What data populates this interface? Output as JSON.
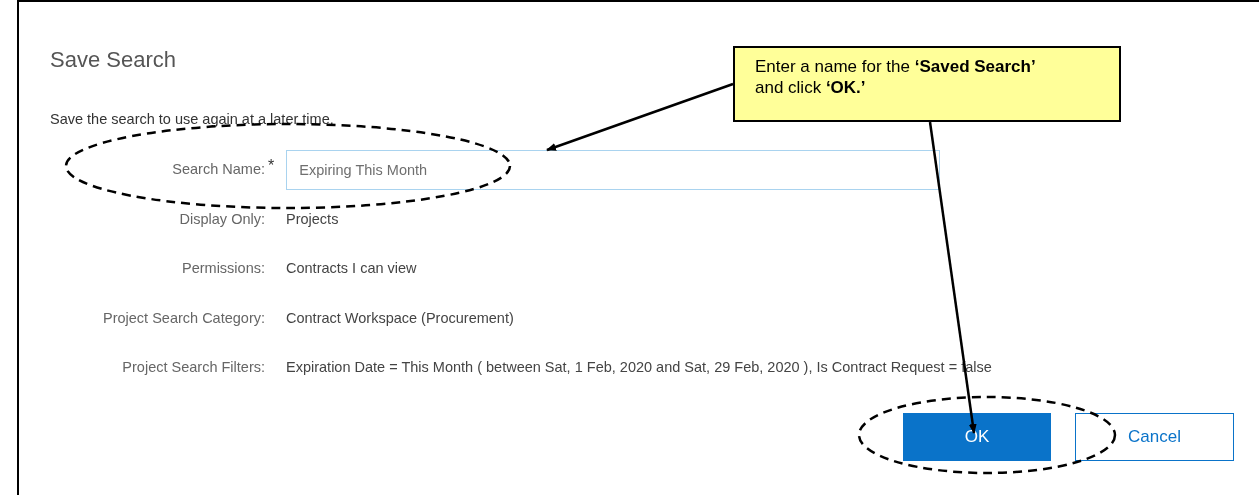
{
  "dialog": {
    "title": "Save Search",
    "description": "Save the search to use again at a later time.",
    "fields": [
      {
        "kind": "input",
        "label": "Search Name:",
        "required_mark": "*",
        "value": "Expiring This Month"
      },
      {
        "kind": "text",
        "label": "Display Only:",
        "value": "Projects"
      },
      {
        "kind": "text",
        "label": "Permissions:",
        "value": "Contracts I can view"
      },
      {
        "kind": "text",
        "label": "Project Search Category:",
        "value": "Contract Workspace (Procurement)"
      },
      {
        "kind": "text",
        "label": "Project Search Filters:",
        "value": "Expiration Date = This Month ( between Sat, 1 Feb, 2020 and Sat, 29 Feb, 2020 ), Is Contract Request = false"
      }
    ],
    "buttons": [
      {
        "kind": "primary",
        "label": "OK"
      },
      {
        "kind": "secondary",
        "label": "Cancel"
      }
    ]
  },
  "annotation": {
    "callout": "Enter a name for the **‘Saved Search’** and click **‘OK.’**"
  }
}
